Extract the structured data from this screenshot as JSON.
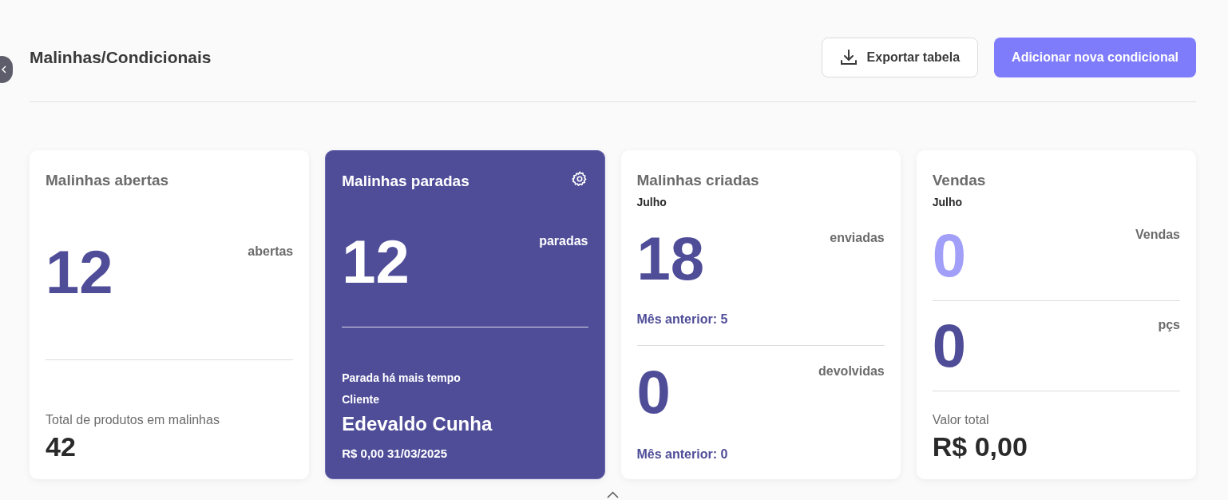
{
  "header": {
    "title": "Malinhas/Condicionais",
    "export_button": "Exportar tabela",
    "add_button": "Adicionar nova condicional"
  },
  "cards": [
    {
      "kind": "total",
      "title": "Malinhas abertas",
      "value": "12",
      "unit": "abertas",
      "footer_label": "Total de produtos em malinhas",
      "footer_value": "42"
    },
    {
      "kind": "stalled",
      "title": "Malinhas paradas",
      "value": "12",
      "unit": "paradas",
      "caption": "Parada há mais tempo",
      "client_label": "Cliente",
      "client": "Edevaldo Cunha",
      "details": "R$ 0,00 31/03/2025"
    },
    {
      "kind": "monthly",
      "title": "Malinhas criadas",
      "month": "Julho",
      "sections": [
        {
          "value": "18",
          "unit": "enviadas",
          "note": "Mês anterior: 5",
          "faded": false
        },
        {
          "value": "0",
          "unit": "devolvidas",
          "note": "Mês anterior: 0",
          "faded": false
        }
      ]
    },
    {
      "kind": "sales",
      "title": "Vendas",
      "month": "Julho",
      "sections": [
        {
          "value": "0",
          "unit": "Vendas",
          "faded": true
        },
        {
          "value": "0",
          "unit": "pçs",
          "faded": false
        }
      ],
      "footer_label": "Valor total",
      "footer_value": "R$ 0,00"
    }
  ]
}
